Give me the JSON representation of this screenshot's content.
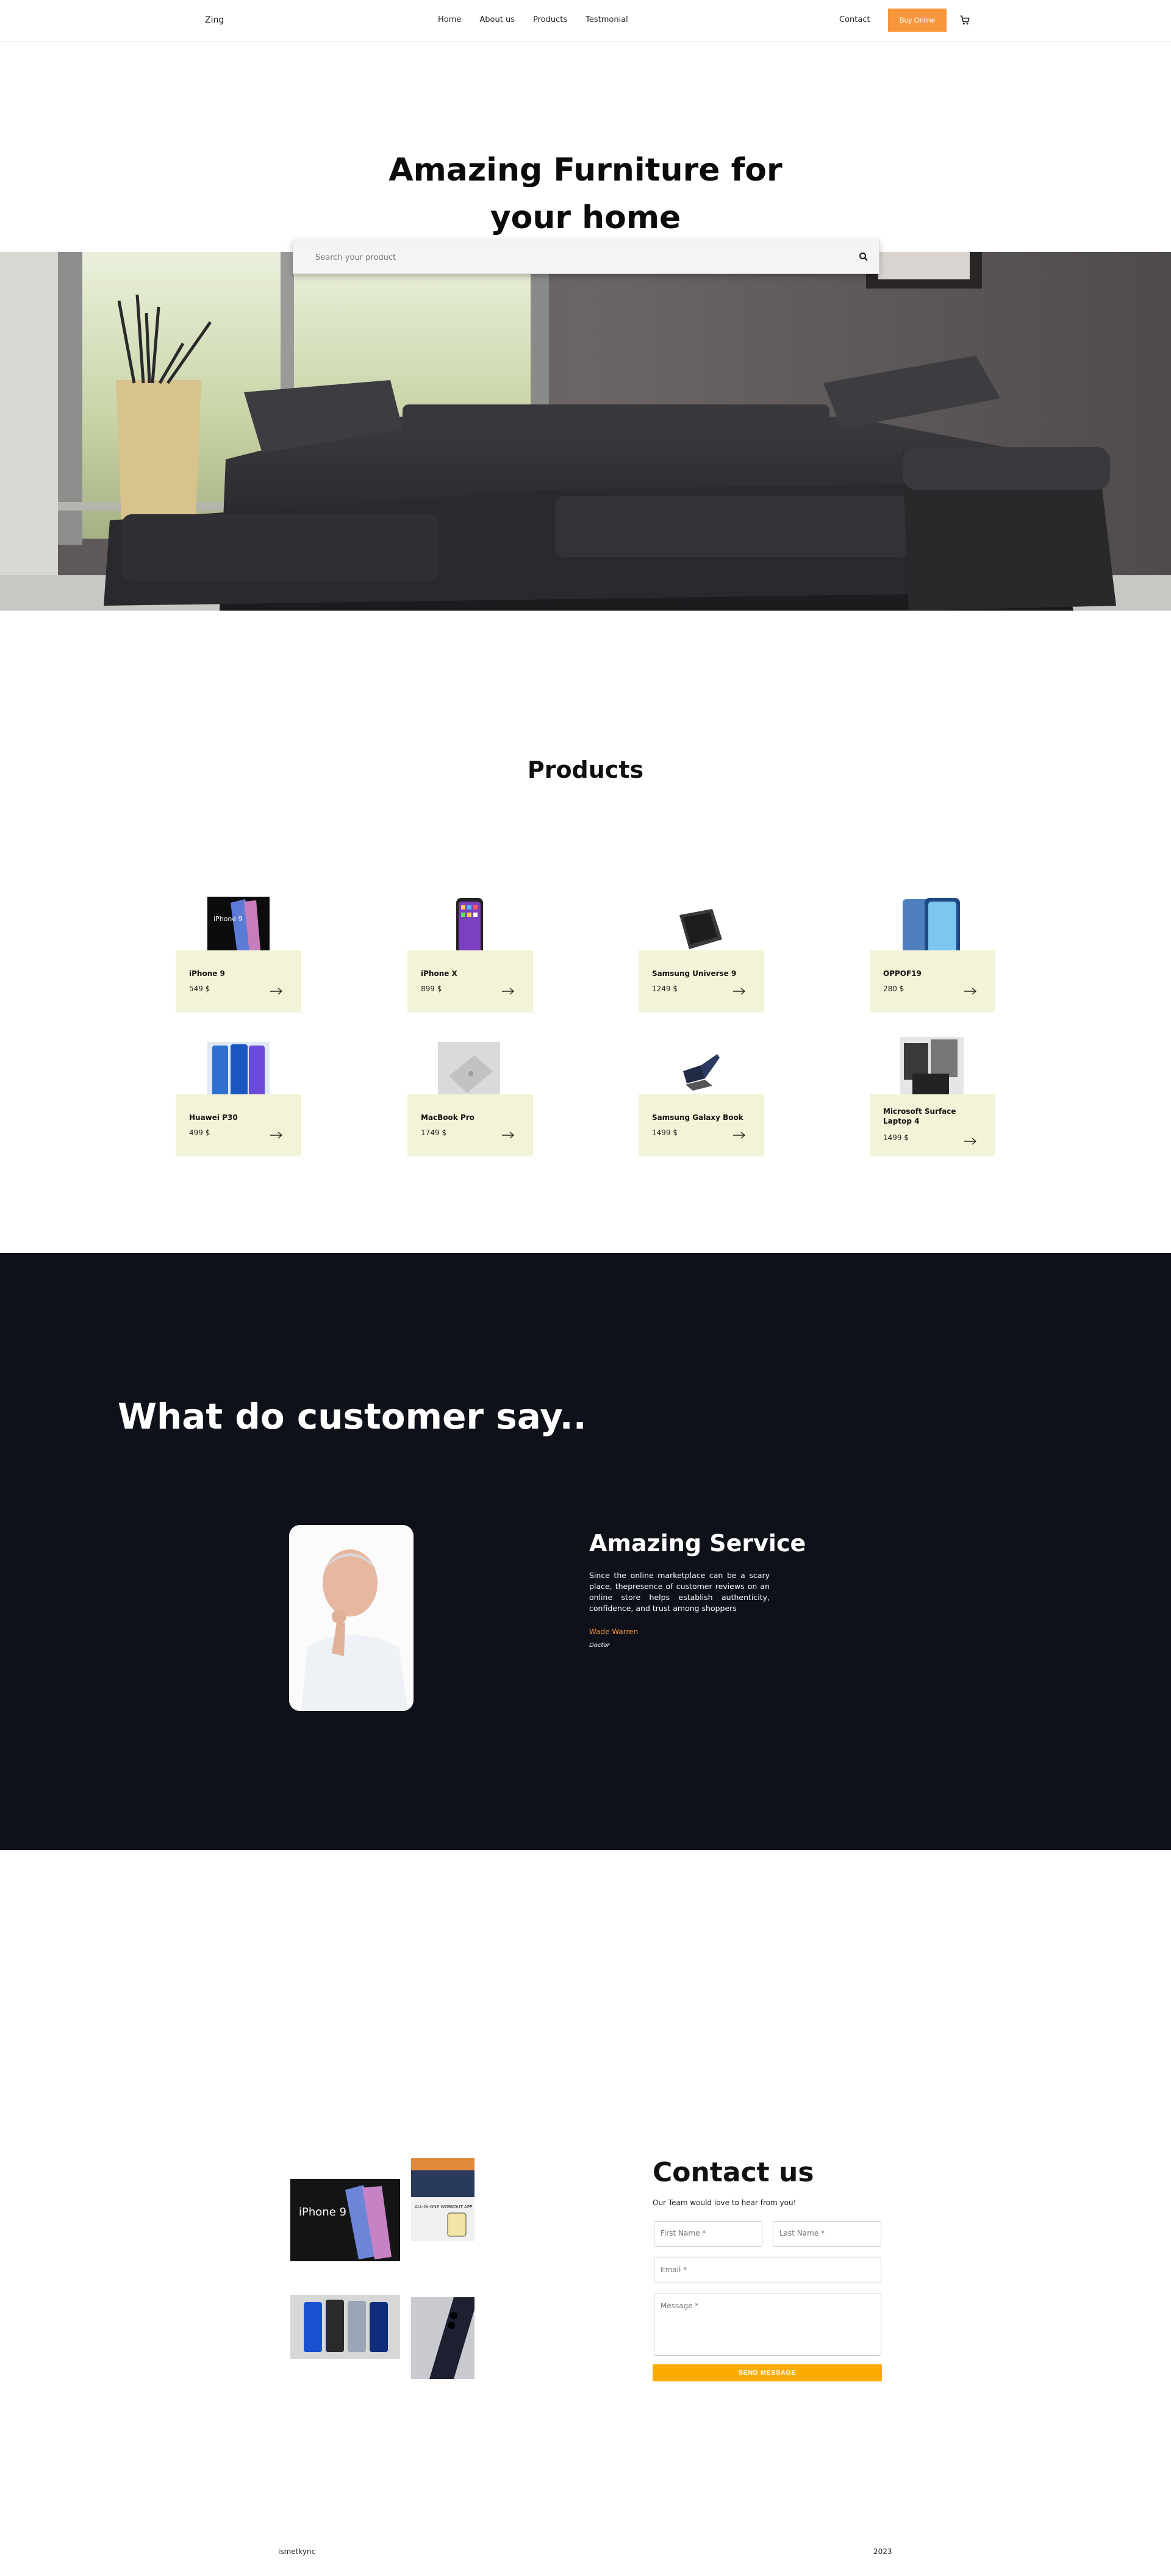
{
  "nav": {
    "brand": "Zing",
    "links": [
      "Home",
      "About us",
      "Products",
      "Testmonial"
    ],
    "contact": "Contact",
    "buy_label": "Buy Online"
  },
  "hero": {
    "title_line1": "Amazing Furniture for",
    "title_line2": "your home",
    "search_placeholder": "Search your product"
  },
  "products": {
    "title": "Products",
    "items": [
      {
        "name": "iPhone 9",
        "price": "549 $"
      },
      {
        "name": "iPhone X",
        "price": "899 $"
      },
      {
        "name": "Samsung Universe 9",
        "price": "1249 $"
      },
      {
        "name": "OPPOF19",
        "price": "280 $"
      },
      {
        "name": "Huawei P30",
        "price": "499 $"
      },
      {
        "name": "MacBook Pro",
        "price": "1749 $"
      },
      {
        "name": "Samsung Galaxy Book",
        "price": "1499 $"
      },
      {
        "name": "Microsoft Surface Laptop 4",
        "price": "1499 $"
      }
    ]
  },
  "testimonial": {
    "heading": "What do customer say..",
    "title": "Amazing Service",
    "text": "Since the online marketplace can be a scary place, thepresence of customer reviews on an online store helps establish authenticity, confidence, and trust among shoppers",
    "name": "Wade Warren",
    "role": "Doctor"
  },
  "contact": {
    "title": "Contact us",
    "subtitle": "Our Team would love to hear from you!",
    "first_name": "First Name *",
    "last_name": "Last Name *",
    "email": "Email *",
    "message": "Message *",
    "send": "SEND MESSAGE",
    "promo_iphone": "iPhone 9",
    "promo_small_text": "ALL-IN-ONE\nWORKOUT\nAPP"
  },
  "footer": {
    "left": "ismetkync",
    "right": "2023"
  },
  "colors": {
    "accent": "#f7963a",
    "send_button": "#fbab00",
    "card_bg": "#f3f3d8",
    "dark_section": "#0e1119"
  }
}
